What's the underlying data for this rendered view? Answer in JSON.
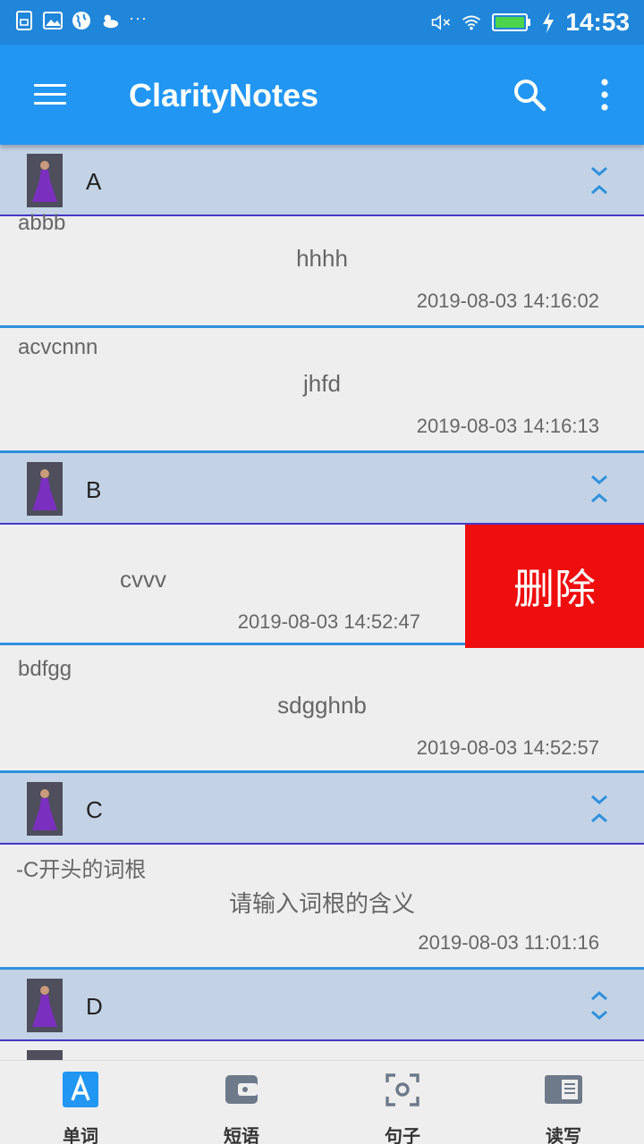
{
  "status_bar": {
    "time": "14:53",
    "more": "···"
  },
  "app_bar": {
    "title": "ClarityNotes"
  },
  "groups": [
    {
      "letter": "A"
    },
    {
      "letter": "B"
    },
    {
      "letter": "C"
    },
    {
      "letter": "D"
    }
  ],
  "items": [
    {
      "word": "abbb",
      "meaning": "hhhh",
      "date": "2019-08-03 14:16:02"
    },
    {
      "word": "acvcnnn",
      "meaning": "jhfd",
      "date": "2019-08-03 14:16:13"
    },
    {
      "word": "",
      "meaning": "cvvv",
      "date": "2019-08-03 14:52:47"
    },
    {
      "word": "bdfgg",
      "meaning": "sdgghnb",
      "date": "2019-08-03 14:52:57"
    },
    {
      "word": "-C开头的词根",
      "meaning": "请输入词根的含义",
      "date": "2019-08-03 11:01:16"
    }
  ],
  "swipe_action": {
    "delete_label": "删除"
  },
  "bottom_nav": [
    {
      "label": "单词",
      "icon": "letter-a-icon",
      "active": true
    },
    {
      "label": "短语",
      "icon": "wallet-icon"
    },
    {
      "label": "句子",
      "icon": "scan-icon"
    },
    {
      "label": "读写",
      "icon": "book-icon"
    }
  ],
  "colors": {
    "primary": "#2196f3",
    "status_bar": "#1f86da",
    "header_bg": "#c3d3e5",
    "delete": "#ee0e0e",
    "divider": "#2f90dd"
  }
}
